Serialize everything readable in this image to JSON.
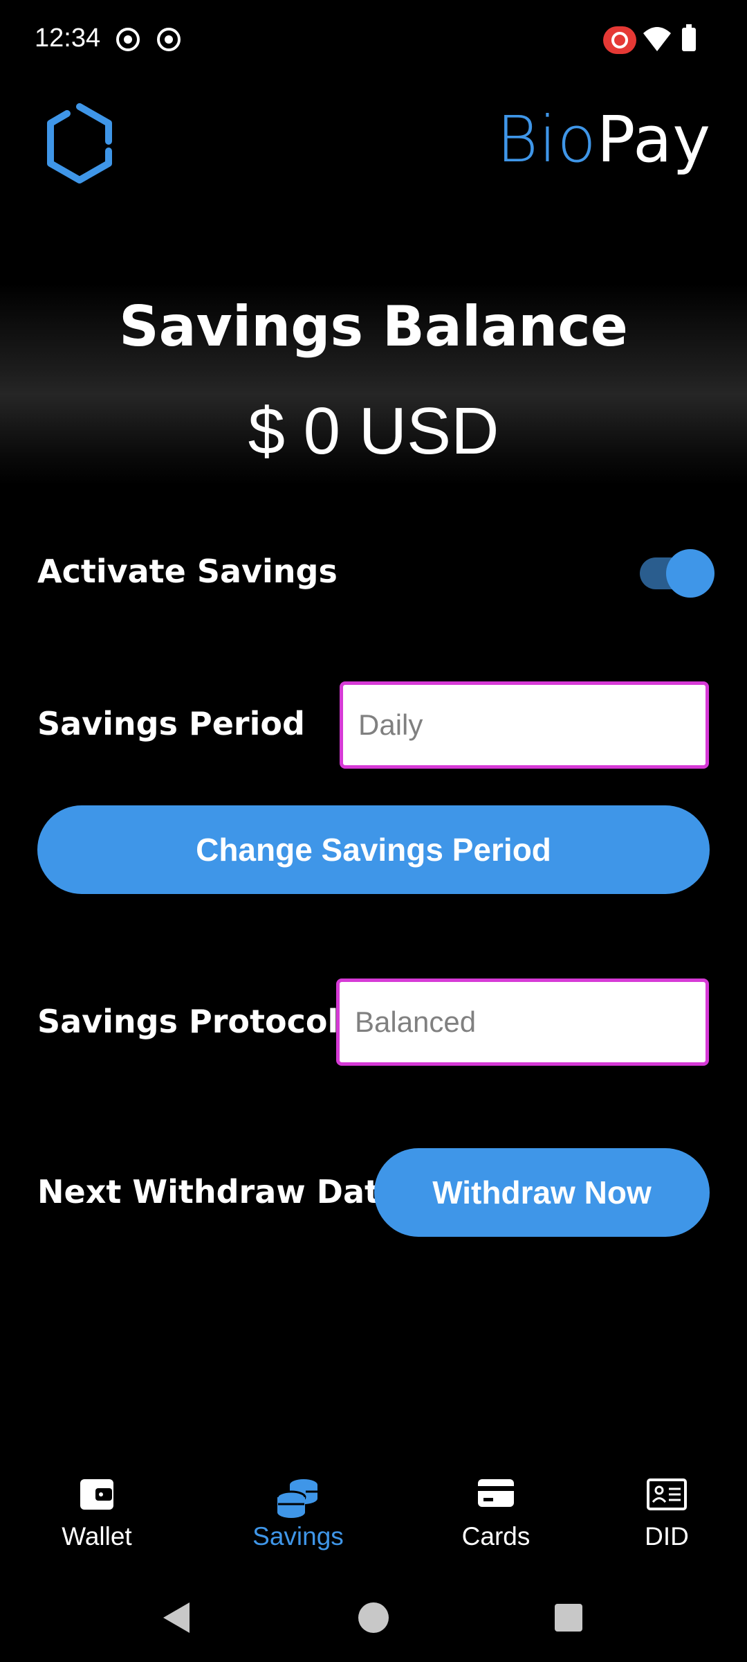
{
  "status_bar": {
    "time": "12:34"
  },
  "header": {
    "brand_part1": "Bio",
    "brand_part2": "Pay"
  },
  "balance": {
    "title": "Savings Balance",
    "amount": "$ 0 USD"
  },
  "activate_savings": {
    "label": "Activate Savings",
    "enabled": true
  },
  "savings_period": {
    "label": "Savings Period",
    "placeholder": "Daily",
    "button_label": "Change Savings Period"
  },
  "savings_protocol": {
    "label": "Savings Protocol",
    "placeholder": "Balanced"
  },
  "withdraw": {
    "label": "Next Withdraw Date",
    "button_label": "Withdraw Now"
  },
  "bottom_nav": {
    "items": [
      {
        "label": "Wallet",
        "icon": "wallet-icon",
        "active": false
      },
      {
        "label": "Savings",
        "icon": "coins-icon",
        "active": true
      },
      {
        "label": "Cards",
        "icon": "credit-card-icon",
        "active": false
      },
      {
        "label": "DID",
        "icon": "id-card-icon",
        "active": false
      }
    ]
  },
  "colors": {
    "accent": "#3f96e8",
    "field_border": "#d63ad6",
    "background": "#000000",
    "toggle_track": "#2a5d8e"
  }
}
